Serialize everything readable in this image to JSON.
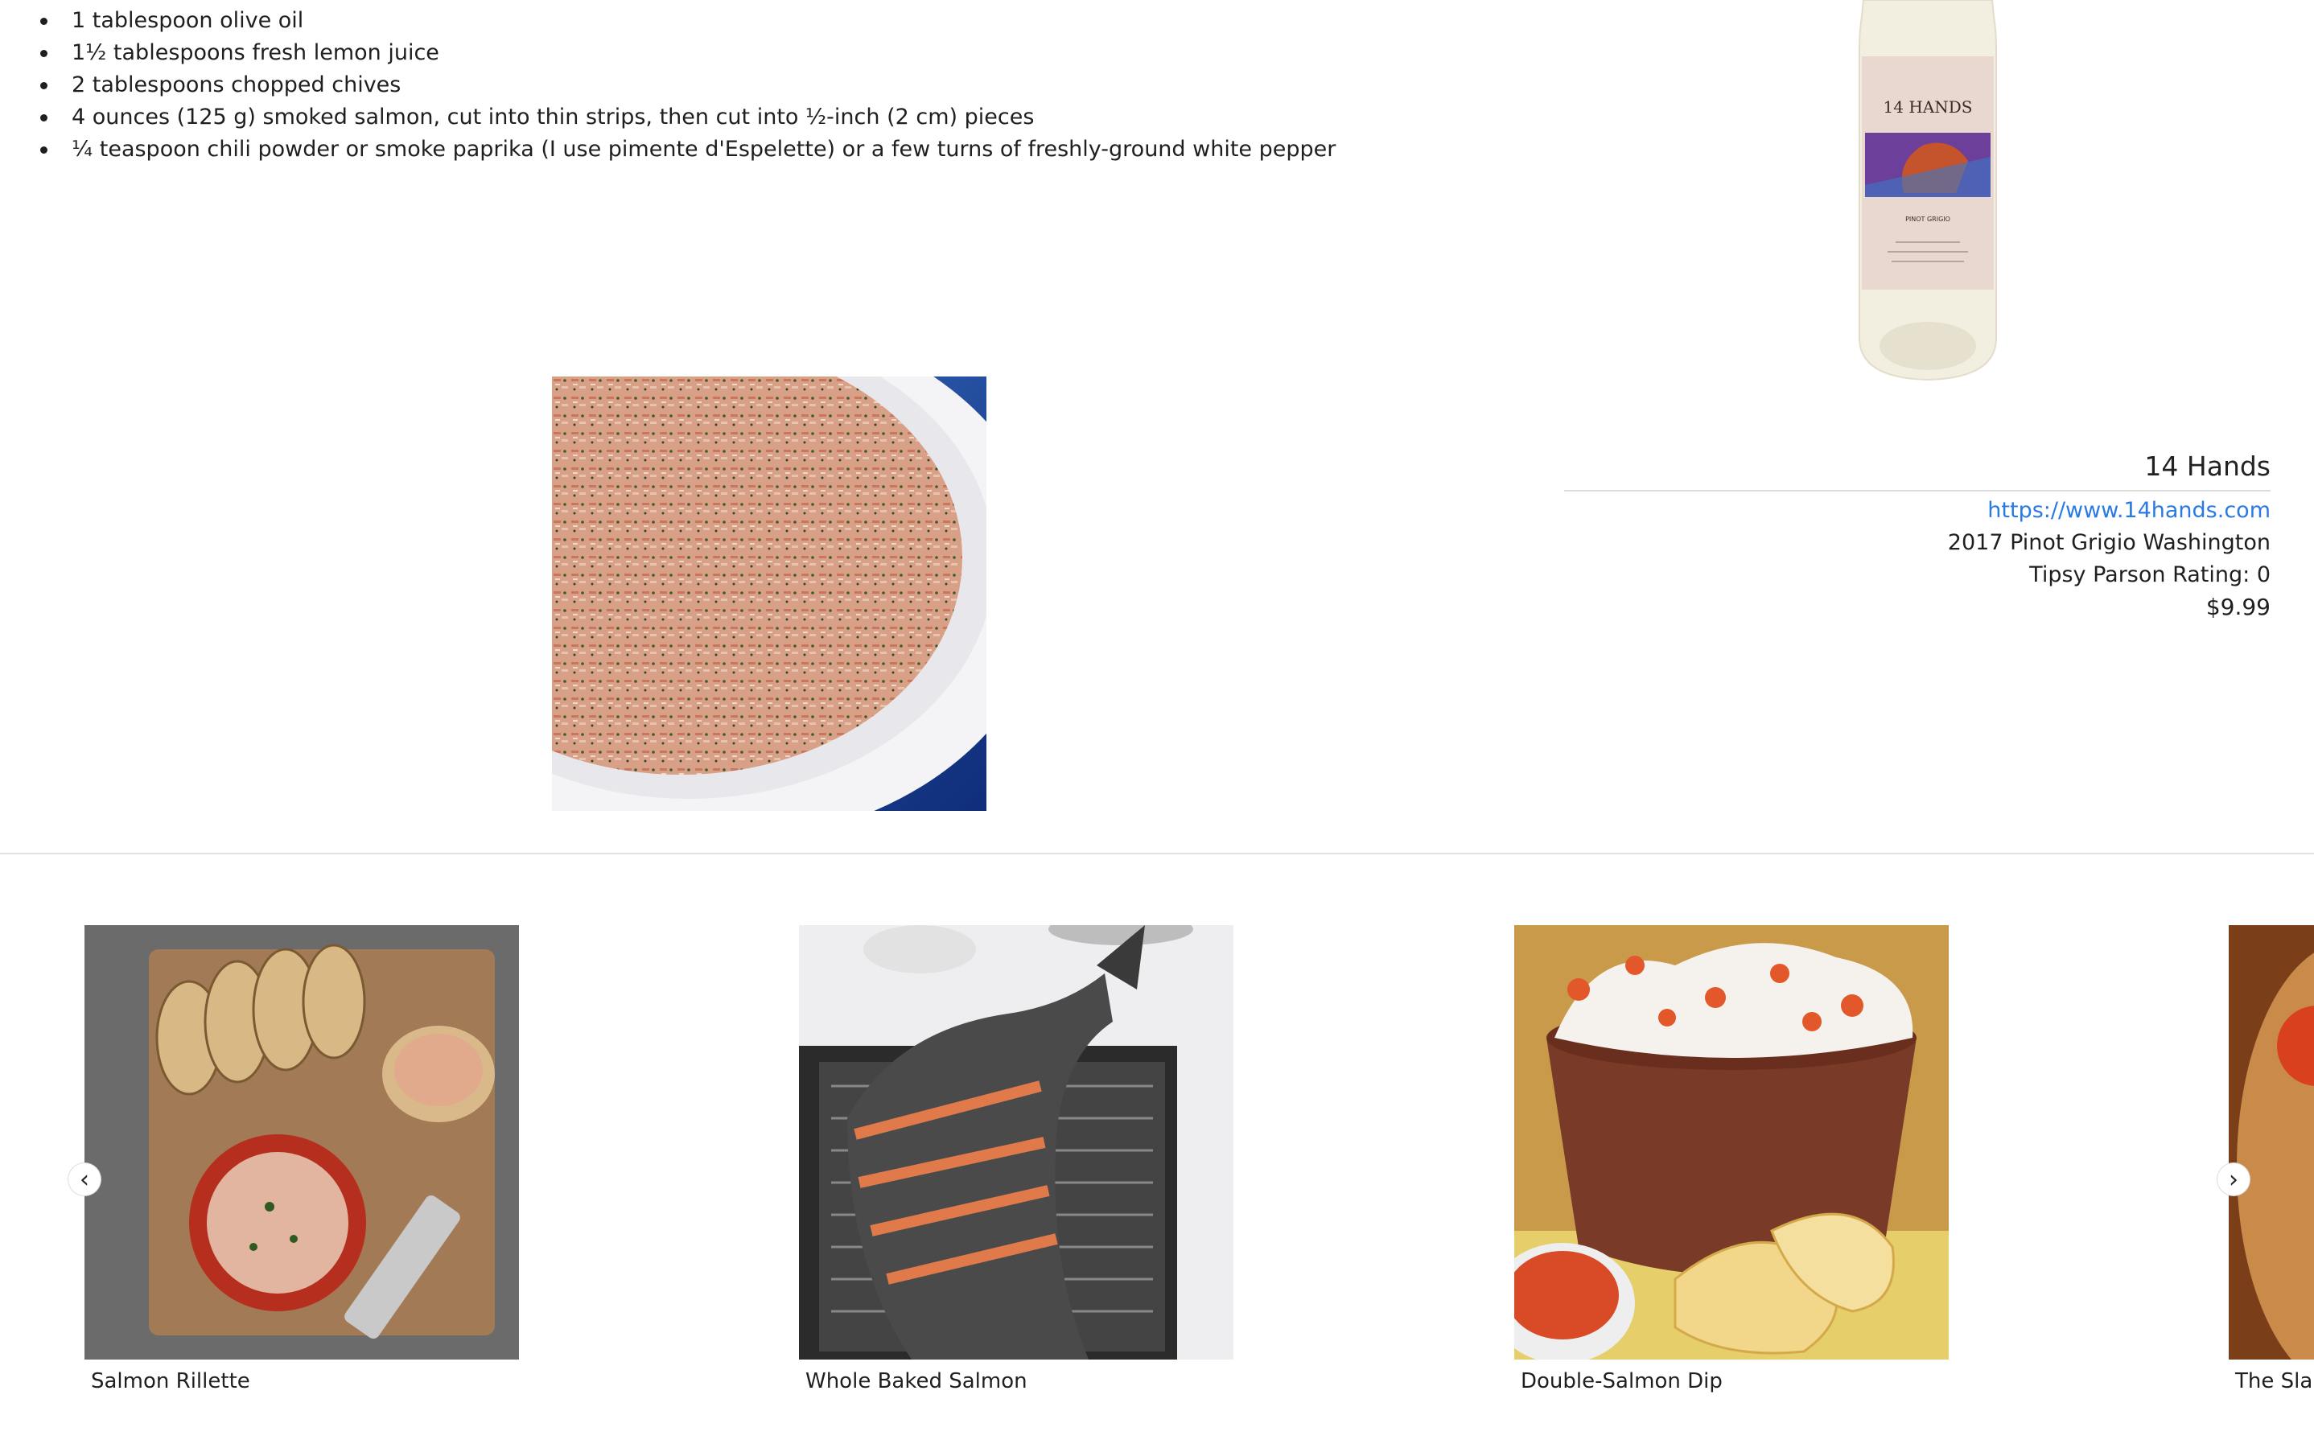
{
  "ingredients": [
    "1 tablespoon olive oil",
    "1½ tablespoons fresh lemon juice",
    "2 tablespoons chopped chives",
    "4 ounces (125 g) smoked salmon, cut into thin strips, then cut into ½-inch (2 cm) pieces",
    "¼ teaspoon chili powder or smoke paprika (I use pimente d'Espelette) or a few turns of freshly-ground white pepper"
  ],
  "bottle_label": {
    "brand": "14 HANDS",
    "varietal": "PINOT GRIGIO"
  },
  "wine": {
    "name": "14 Hands",
    "url": "https://www.14hands.com",
    "vintage": "2017 Pinot Grigio Washington",
    "rating": "Tipsy Parson Rating: 0",
    "price": "$9.99"
  },
  "related": [
    {
      "title": "Salmon Rillette"
    },
    {
      "title": "Whole Baked Salmon"
    },
    {
      "title": "Double-Salmon Dip"
    },
    {
      "title": "The Slan"
    }
  ],
  "icons": {
    "prev": "chevron-left-icon",
    "next": "chevron-right-icon"
  },
  "colors": {
    "link": "#2a7ae4",
    "text": "#1f1f1f",
    "divider": "#e2e2e2"
  }
}
